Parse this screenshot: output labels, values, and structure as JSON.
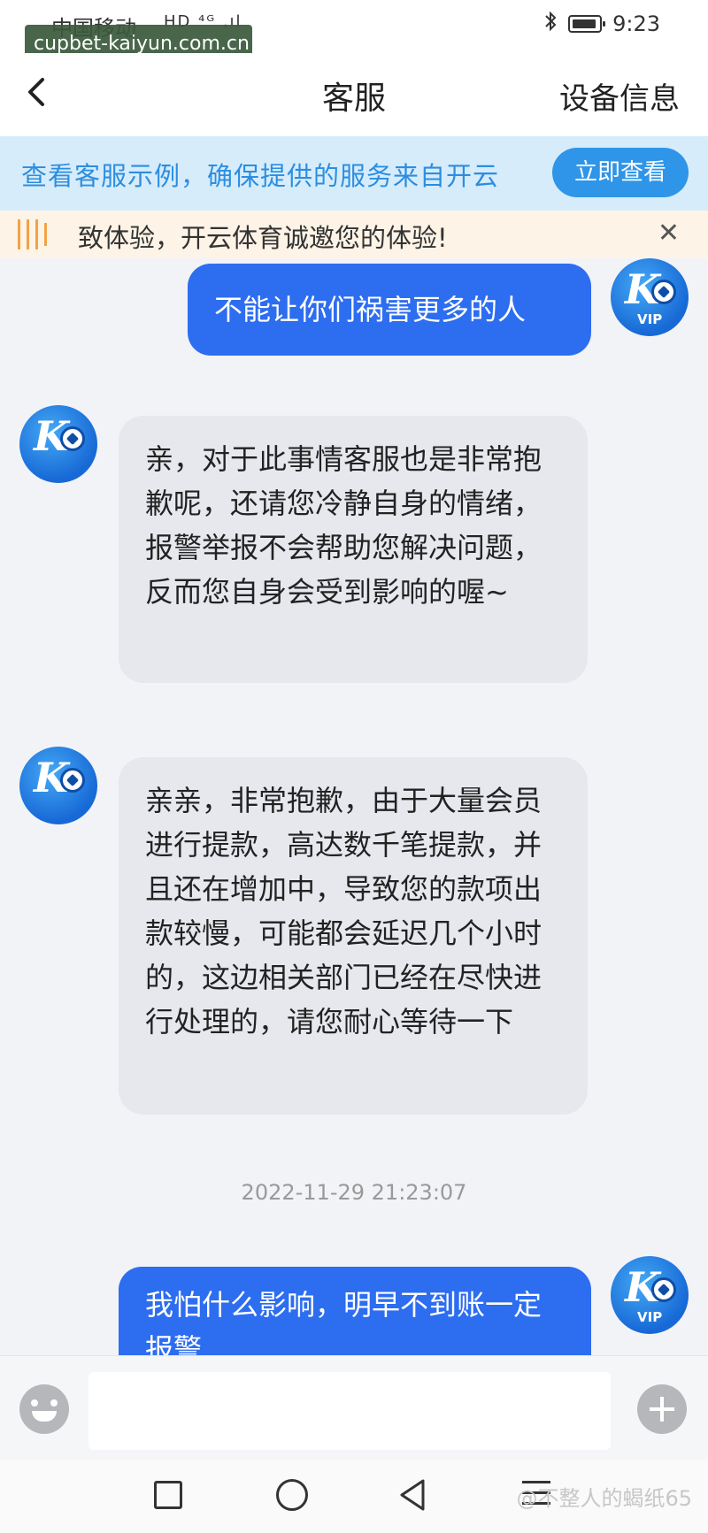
{
  "status_bar": {
    "carrier": "中国移动",
    "net": "HD ⁴ᴳ .ıl",
    "time": "9:23"
  },
  "watermark_top": "cupbet-kaiyun.com.cn",
  "header": {
    "title": "客服",
    "device_info": "设备信息"
  },
  "banner": {
    "text": "查看客服示例，确保提供的服务来自开云",
    "button": "立即查看"
  },
  "notice": {
    "text": "致体验，开云体育诚邀您的体验!"
  },
  "messages": [
    {
      "from": "user",
      "text": "不能让你们祸害更多的人"
    },
    {
      "from": "agent",
      "text": "亲，对于此事情客服也是非常抱歉呢，还请您冷静自身的情绪，报警举报不会帮助您解决问题，反而您自身会受到影响的喔~"
    },
    {
      "from": "agent",
      "text": "亲亲，非常抱歉，由于大量会员进行提款，高达数千笔提款，并且还在增加中，导致您的款项出款较慢，可能都会延迟几个小时的，这边相关部门已经在尽快进行处理的，请您耐心等待一下"
    },
    {
      "from": "user",
      "text": "我怕什么影响，明早不到账一定报警"
    }
  ],
  "timestamp": "2022-11-29 21:23:07",
  "avatar": {
    "vip": "VIP"
  },
  "watermark_bottom": "@不整人的蝎纸65",
  "icons": [
    "back-icon",
    "bluetooth-icon",
    "battery-icon",
    "close-icon",
    "emoji-icon",
    "plus-icon",
    "nav-home-icon",
    "nav-back-icon",
    "nav-menu-icon"
  ]
}
